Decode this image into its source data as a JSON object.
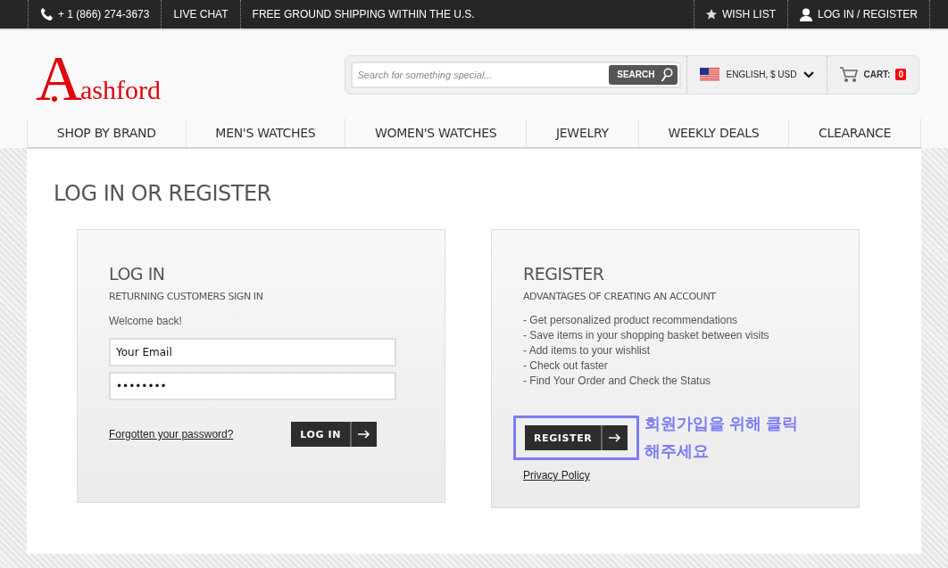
{
  "top_bar": {
    "phone": "+ 1 (866) 274-3673",
    "live_chat": "LIVE CHAT",
    "promo": "FREE GROUND SHIPPING WITHIN THE U.S.",
    "wish_list": "WISH LIST",
    "account": "LOG IN / REGISTER"
  },
  "header": {
    "logo": {
      "initial": "A",
      "word": "ashford"
    },
    "search": {
      "placeholder": "Search for something special...",
      "button": "SEARCH"
    },
    "locale": "ENGLISH, $ USD",
    "cart": {
      "label": "CART:",
      "count": "0"
    }
  },
  "nav": [
    "SHOP BY BRAND",
    "MEN'S WATCHES",
    "WOMEN'S WATCHES",
    "JEWELRY",
    "WEEKLY DEALS",
    "CLEARANCE"
  ],
  "page_title": "LOG IN OR REGISTER",
  "login": {
    "title": "LOG IN",
    "subtitle": "RETURNING CUSTOMERS SIGN IN",
    "welcome": "Welcome back!",
    "email": "Your Email",
    "password": "••••••••",
    "forgot": "Forgotten your password?",
    "button": "LOG IN"
  },
  "register": {
    "title": "REGISTER",
    "subtitle": "ADVANTAGES OF CREATING AN ACCOUNT",
    "benefits": [
      "- Get personalized product recommendations",
      "- Save items in your shopping basket between visits",
      "- Add items to your wishlist",
      "- Check out faster",
      "- Find Your Order and Check the Status"
    ],
    "button": "REGISTER",
    "privacy": "Privacy Policy"
  },
  "annotation": {
    "text": "회원가입을 위해 클릭 해주세요",
    "color": "#7b7bf5"
  }
}
